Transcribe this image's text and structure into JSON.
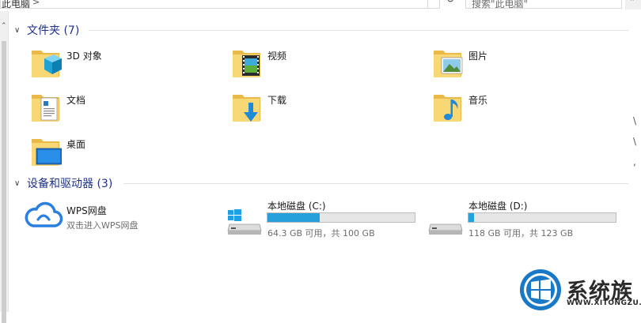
{
  "address_bar": {
    "path": "此电脑",
    "separator": ">"
  },
  "search": {
    "placeholder": "搜索\"此电脑\""
  },
  "groups": {
    "folders": {
      "title": "文件夹 (7)"
    },
    "devices": {
      "title": "设备和驱动器 (3)"
    }
  },
  "folders": [
    {
      "label": "3D 对象",
      "icon": "3d-objects-folder-icon"
    },
    {
      "label": "视频",
      "icon": "video-folder-icon"
    },
    {
      "label": "图片",
      "icon": "pictures-folder-icon"
    },
    {
      "label": "文档",
      "icon": "documents-folder-icon"
    },
    {
      "label": "下载",
      "icon": "downloads-folder-icon"
    },
    {
      "label": "音乐",
      "icon": "music-folder-icon"
    },
    {
      "label": "桌面",
      "icon": "desktop-folder-icon"
    }
  ],
  "devices": {
    "wps": {
      "name": "WPS网盘",
      "subtitle": "双击进入WPS网盘",
      "icon": "cloud-icon"
    },
    "drives": [
      {
        "name": "本地磁盘 (C:)",
        "free_text": "64.3 GB 可用，共 100 GB",
        "used_fraction": 0.357,
        "icon": "windows-drive-icon"
      },
      {
        "name": "本地磁盘 (D:)",
        "free_text": "118 GB 可用，共 123 GB",
        "used_fraction": 0.04,
        "icon": "drive-icon"
      }
    ]
  },
  "watermark": {
    "title": "系统族",
    "url": "WWW.XITONGZU.COM"
  },
  "colors": {
    "accent": "#26a0da",
    "group_title": "#1e3287",
    "folder": "#f5c842"
  }
}
